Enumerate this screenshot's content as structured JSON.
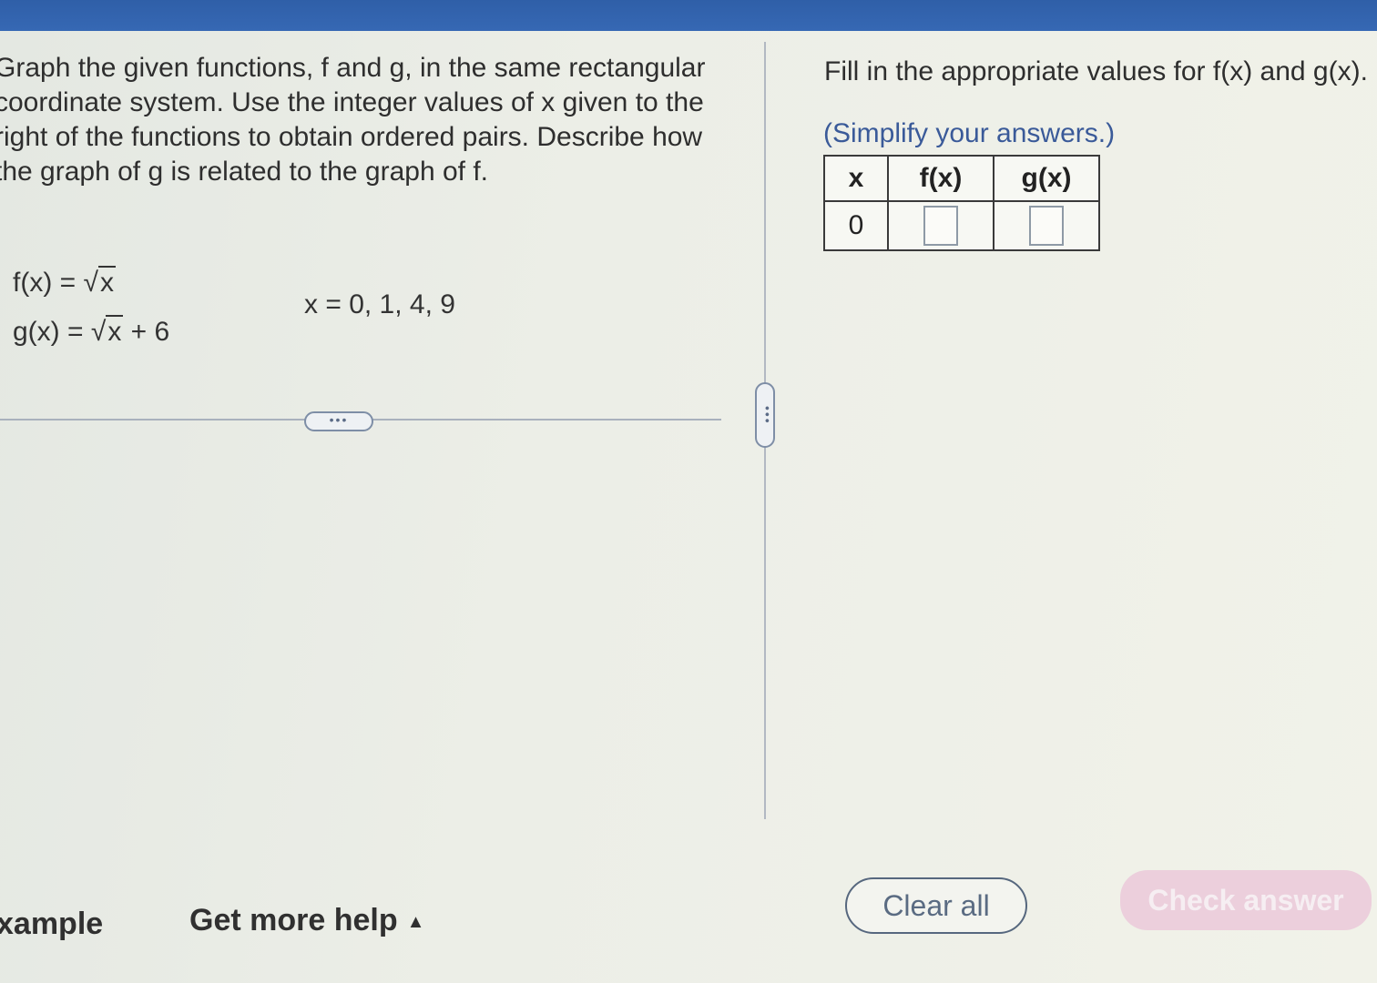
{
  "question": {
    "text": "Graph the given functions, f and g, in the same rectangular coordinate system. Use the integer values of x given to the right of the functions to obtain ordered pairs. Describe how the graph of g is related to the graph of f.",
    "f_prefix": "f(x) = ",
    "f_radicand": "x",
    "g_prefix": "g(x) = ",
    "g_radicand": "x",
    "g_suffix": " + 6",
    "radical_symbol": "√",
    "x_values": "x = 0, 1, 4, 9"
  },
  "dividers": {
    "h_expand_label": "•••",
    "v_expand_label": "•••"
  },
  "answer_panel": {
    "instruction": "Fill in the appropriate values for f(x) and g(x).",
    "simplify_note": "(Simplify your answers.)",
    "table": {
      "headers": [
        "x",
        "f(x)",
        "g(x)"
      ],
      "rows": [
        {
          "x": "0",
          "fx": "",
          "gx": ""
        }
      ]
    }
  },
  "footer": {
    "example_label": "xample",
    "help_label": "Get more help",
    "help_caret": "▲",
    "clear_all": "Clear all",
    "check_answer": "Check answer"
  }
}
